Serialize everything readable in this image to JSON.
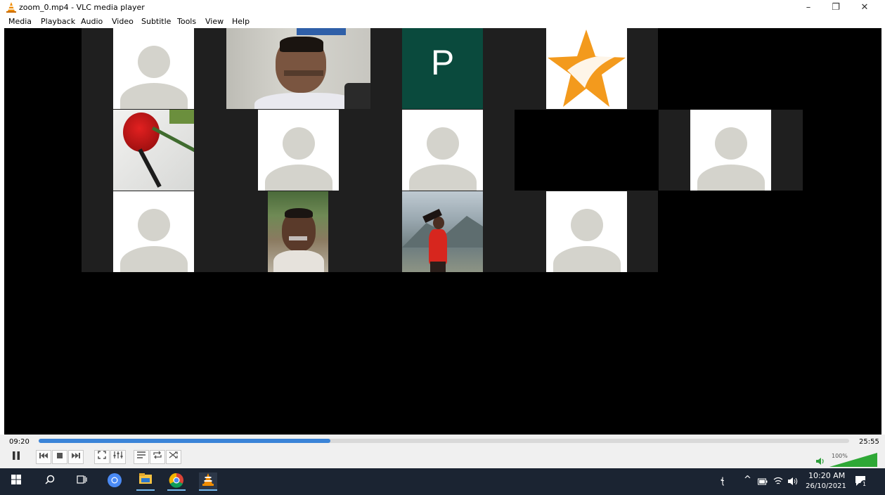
{
  "window": {
    "title": "zoom_0.mp4 - VLC media player",
    "minimize_glyph": "–",
    "restore_glyph": "❐",
    "close_glyph": "✕"
  },
  "menu": [
    "Media",
    "Playback",
    "Audio",
    "Video",
    "Subtitle",
    "Tools",
    "View",
    "Help"
  ],
  "video": {
    "participant_initial": "P",
    "colors": {
      "initial_tile": "#0a4a3d",
      "star": "#f39a1d"
    }
  },
  "player": {
    "time_current": "09:20",
    "time_total": "25:55",
    "progress": 0.36,
    "volume_label": "100%",
    "volume": 1.0,
    "accent": "#3b84d8"
  },
  "taskbar": {
    "time": "10:20 AM",
    "date": "26/10/2021",
    "notification_count": "1",
    "icons": [
      "windows-start-icon",
      "search-icon",
      "task-view-icon",
      "chrome-icon",
      "file-explorer-icon",
      "chrome-icon",
      "vlc-icon"
    ]
  }
}
